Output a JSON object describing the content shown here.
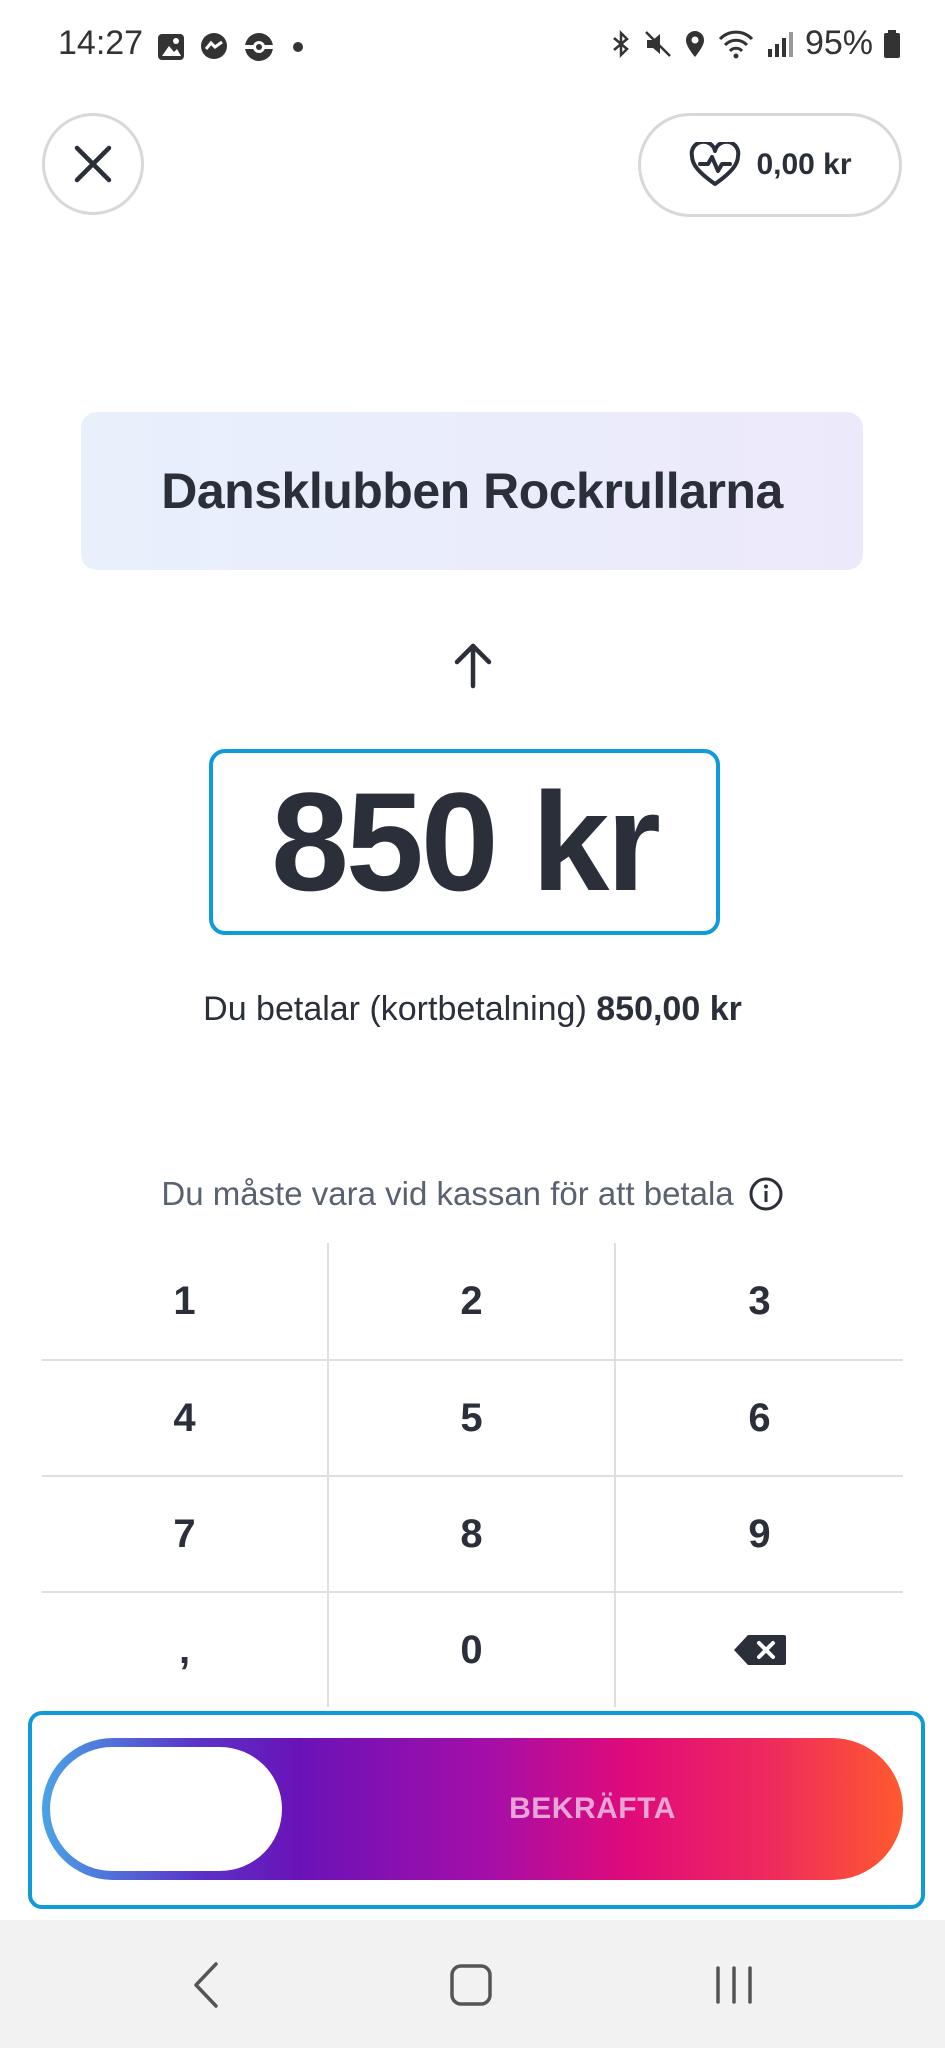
{
  "status_bar": {
    "time": "14:27",
    "battery": "95%",
    "left_icons": [
      "image-icon",
      "messenger-icon",
      "pokeball-icon",
      "dot-icon"
    ],
    "right_icons": [
      "bluetooth-icon",
      "mute-icon",
      "location-icon",
      "wifi-icon",
      "signal-icon",
      "battery-icon"
    ]
  },
  "header": {
    "wallet_amount": "0,00 kr"
  },
  "recipient": {
    "name": "Dansklubben Rockrullarna"
  },
  "amount": {
    "display": "850 kr",
    "pay_prefix": "Du betalar (kortbetalning)",
    "pay_total": "850,00 kr"
  },
  "notice": {
    "text": "Du måste vara vid kassan för att betala"
  },
  "keypad": {
    "keys": [
      "1",
      "2",
      "3",
      "4",
      "5",
      "6",
      "7",
      "8",
      "9",
      ",",
      "0"
    ]
  },
  "confirm": {
    "label": "BEKRÄFTA"
  },
  "colors": {
    "accent_border": "#0f9bd9",
    "text_dark": "#2b2f3a"
  }
}
